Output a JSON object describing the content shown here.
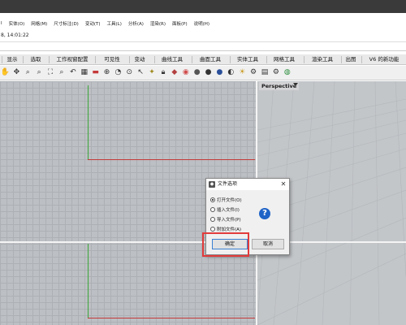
{
  "menu": [
    "I",
    "实体(O)",
    "网格(M)",
    "尺寸标注(D)",
    "变动(T)",
    "工具(L)",
    "分析(A)",
    "渲染(R)",
    "面板(P)",
    "说明(H)"
  ],
  "command": {
    "history_line": "8, 14:01:22"
  },
  "tabs": [
    "显示",
    "选取",
    "工作视窗配置",
    "可见性",
    "变动",
    "曲线工具",
    "曲面工具",
    "实体工具",
    "网格工具",
    "渲染工具",
    "出图",
    "V6 的新功能"
  ],
  "toolbar_icons": [
    "hand-icon",
    "move-icon",
    "zoom-icon",
    "zoom-window-icon",
    "zoom-extents-icon",
    "zoom-selected-icon",
    "undo-view-icon",
    "four-viewports-icon",
    "construction-plane-icon",
    "set-view-icon",
    "camera-icon",
    "view-icon",
    "select-icon",
    "light-icon",
    "lock-icon",
    "material-icon",
    "color-wheel-icon",
    "shaded-sphere-icon",
    "rendered-sphere-icon",
    "ghosted-sphere-icon",
    "render-icon",
    "sun-icon",
    "gear-icon",
    "layout-icon",
    "options-icon",
    "globe-icon"
  ],
  "viewport": {
    "label": "Perspective"
  },
  "dialog": {
    "title": "文件选项",
    "options": [
      {
        "label": "打开文件(O)",
        "checked": true
      },
      {
        "label": "插入文件(I)",
        "checked": false
      },
      {
        "label": "导入文件(P)",
        "checked": false
      },
      {
        "label": "附加文件(A)",
        "checked": false
      }
    ],
    "ok_label": "确定",
    "cancel_label": "取消",
    "help_glyph": "?"
  },
  "colors": {
    "x_axis": "#c53a3a",
    "y_axis": "#3aa63a",
    "highlight": "#e23b3b",
    "help_blue": "#1f63c7"
  }
}
